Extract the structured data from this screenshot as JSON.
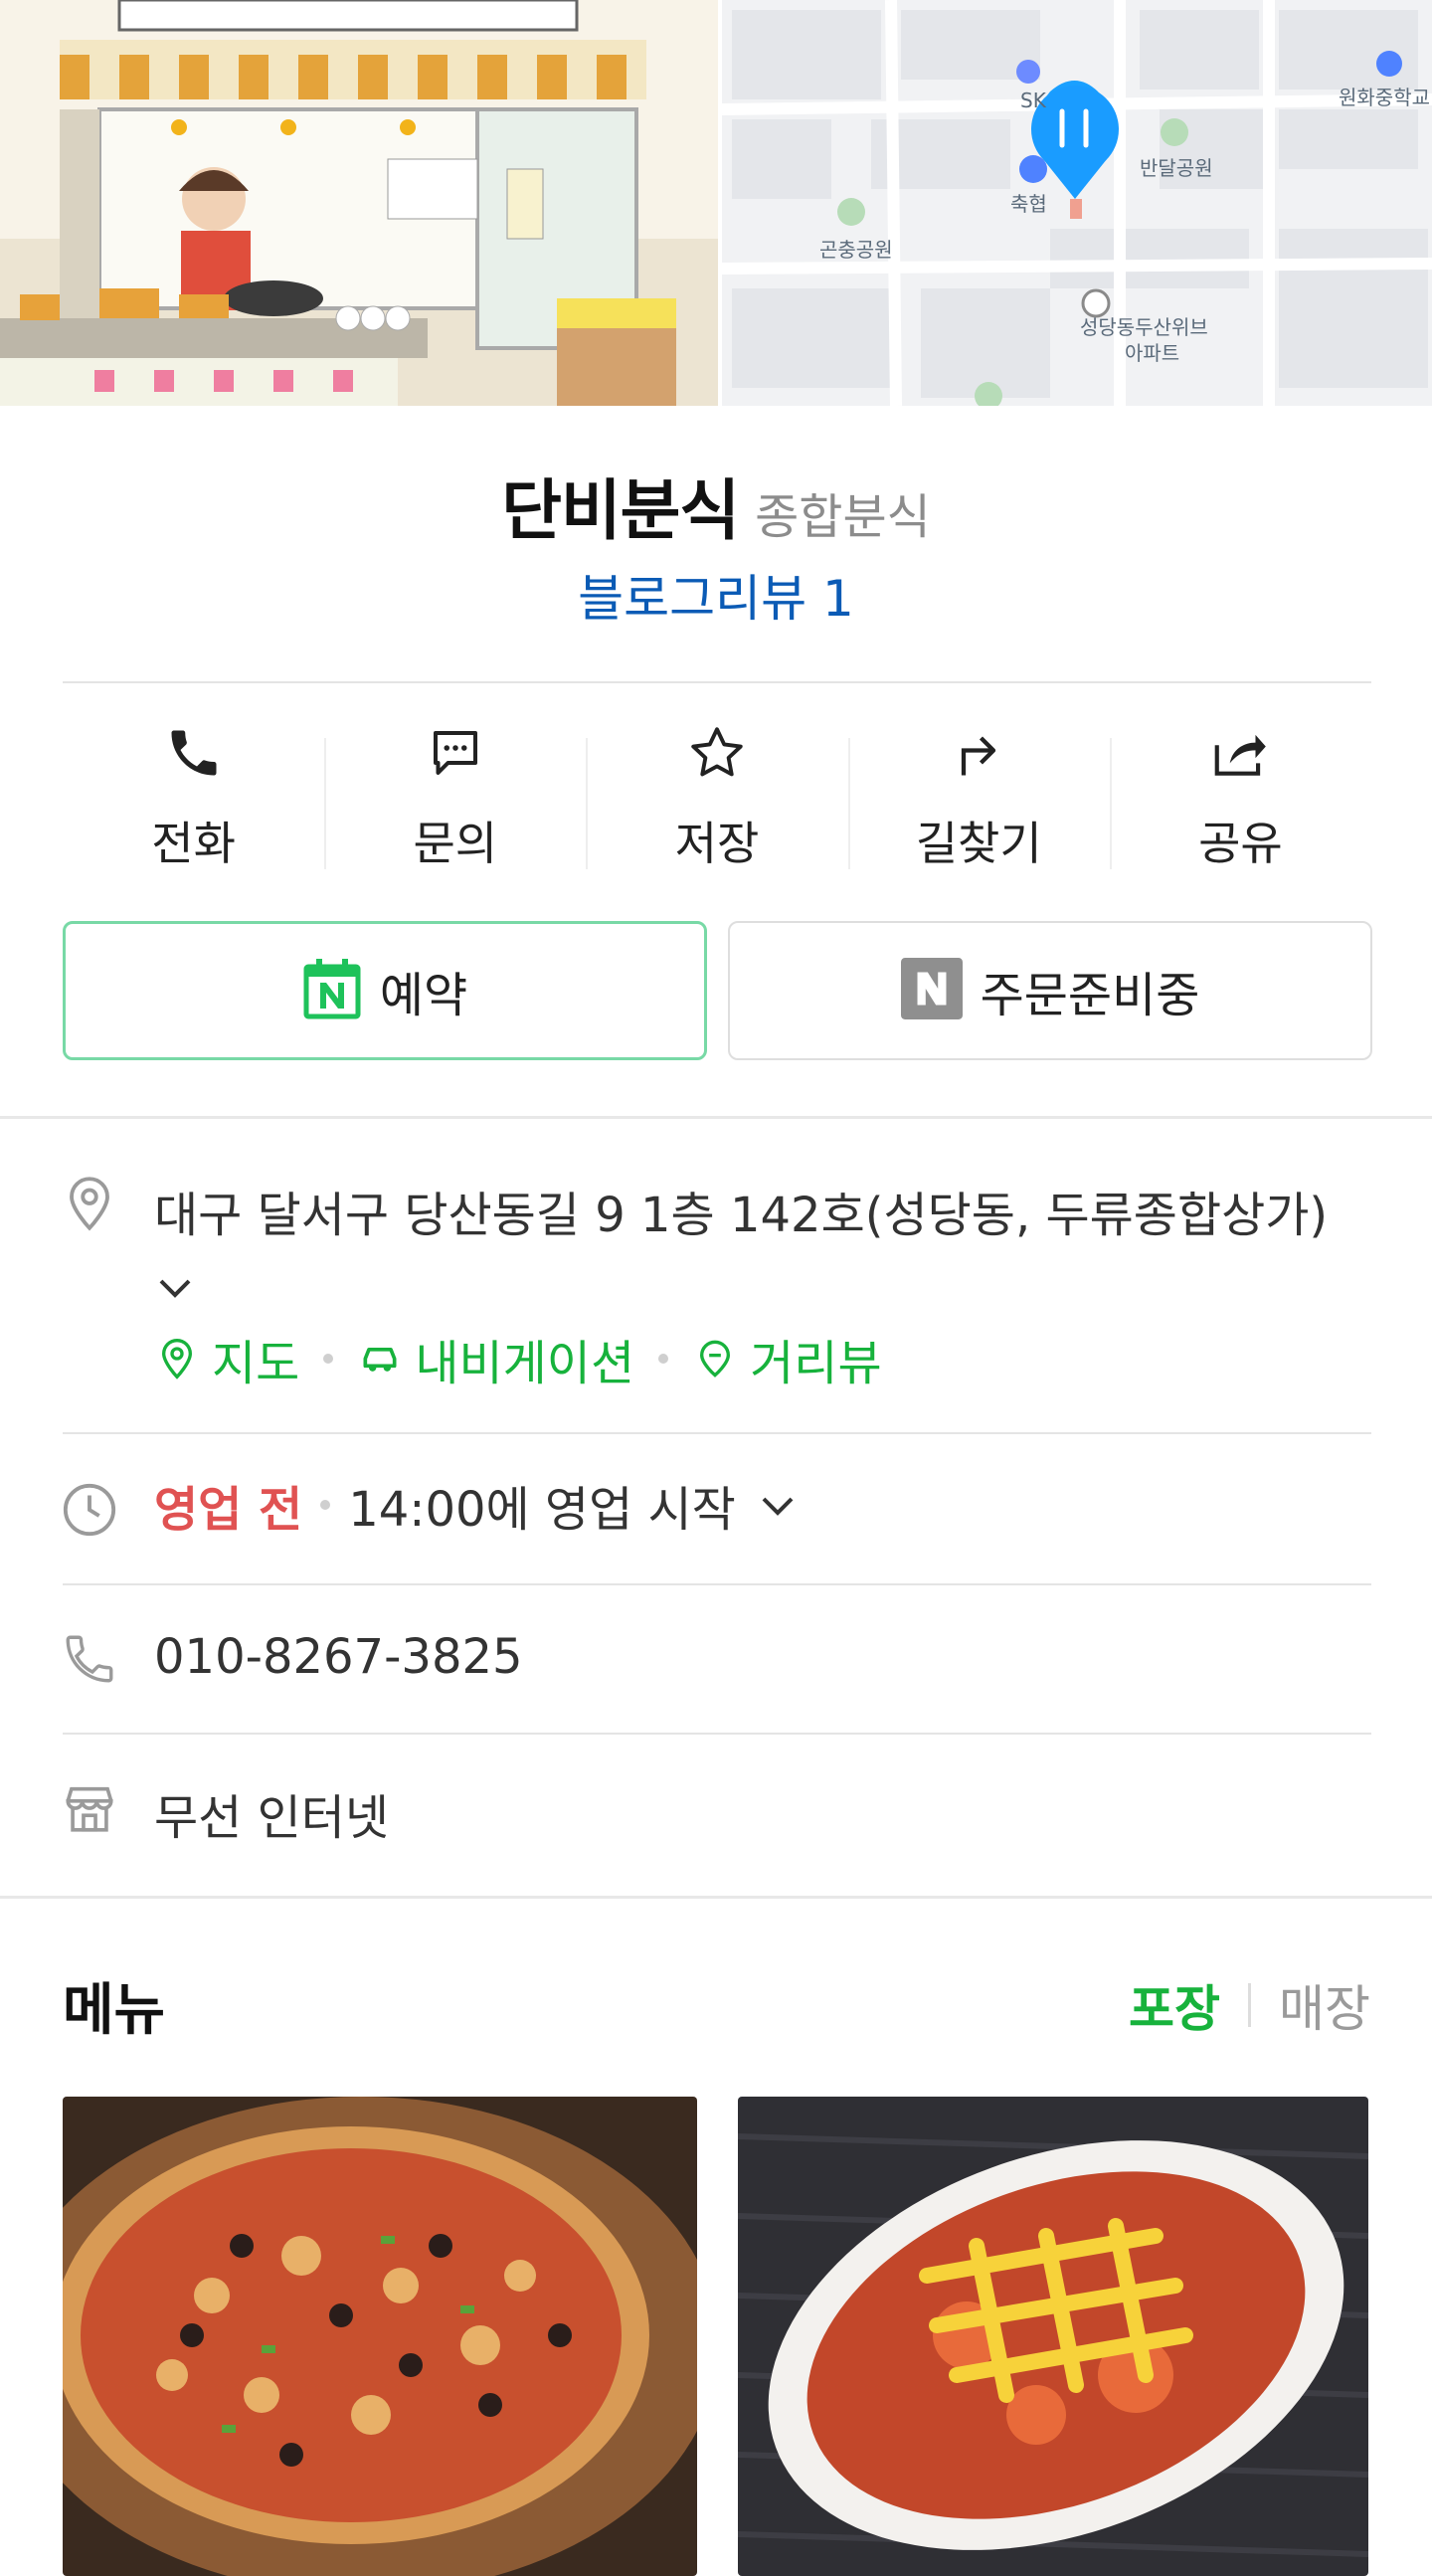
{
  "place": {
    "name": "단비분식",
    "category": "종합분식",
    "review_link": "블로그리뷰 1"
  },
  "map": {
    "labels": [
      "원화중학교",
      "SK",
      "반달공원",
      "축협",
      "곤충공원",
      "성당동두산위브",
      "아파트"
    ]
  },
  "actions": [
    {
      "label": "전화",
      "icon": "phone-icon"
    },
    {
      "label": "문의",
      "icon": "chat-icon"
    },
    {
      "label": "저장",
      "icon": "star-icon"
    },
    {
      "label": "길찾기",
      "icon": "directions-icon"
    },
    {
      "label": "공유",
      "icon": "share-icon"
    }
  ],
  "buttons": {
    "reserve": "예약",
    "order": "주문준비중"
  },
  "address": {
    "text": "대구 달서구 당산동길 9 1층 142호(성당동, 두류종합상가)",
    "links": {
      "map": "지도",
      "navigation": "내비게이션",
      "street_view": "거리뷰"
    }
  },
  "hours": {
    "status": "영업 전",
    "text": "14:00에 영업 시작"
  },
  "phone": "010-8267-3825",
  "amenity": "무선 인터넷",
  "menu": {
    "title": "메뉴",
    "tabs": {
      "takeout": "포장",
      "dine_in": "매장"
    }
  },
  "colors": {
    "link_blue": "#0b5bb5",
    "naver_green": "#17b23c",
    "status_red": "#e05252",
    "reserve_border": "#78d9a6"
  }
}
